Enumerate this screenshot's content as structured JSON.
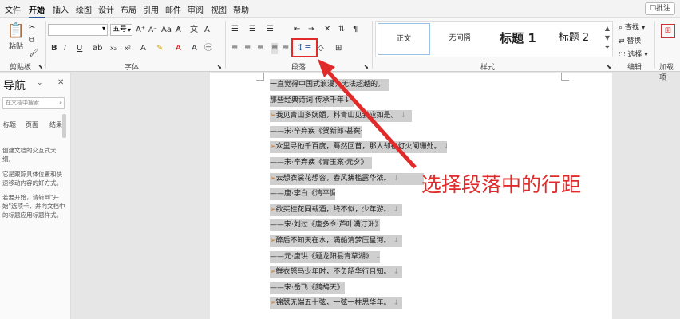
{
  "menu": {
    "items": [
      "文件",
      "开始",
      "插入",
      "绘图",
      "设计",
      "布局",
      "引用",
      "邮件",
      "审阅",
      "视图",
      "帮助"
    ],
    "active": "开始",
    "comment_label": "批注"
  },
  "ribbon": {
    "clipboard": {
      "paste_label": "粘贴",
      "group_label": "剪贴板"
    },
    "font": {
      "font_name": "",
      "font_size": "五号",
      "group_label": "字体",
      "bold": "B",
      "italic": "I",
      "underline": "U"
    },
    "paragraph": {
      "group_label": "段落"
    },
    "styles": {
      "group_label": "样式",
      "items": [
        "正文",
        "无间隔",
        "标题 1",
        "标题 2"
      ]
    },
    "editing": {
      "find_label": "查找",
      "replace_label": "替换",
      "select_label": "选择",
      "group_label": "编辑"
    },
    "addins": {
      "group_label": "加载项"
    }
  },
  "nav": {
    "title": "导航",
    "search_placeholder": "在文档中搜索",
    "tabs": [
      "标题",
      "页面",
      "结果"
    ],
    "help_1": "创建文档的交互式大纲。",
    "help_2": "它是跟踪具体位置和快速移动内容的好方式。",
    "help_3": "若要开始，请转到\"开始\"选项卡，并向文档中的标题应用标题样式。"
  },
  "document": {
    "lines": [
      {
        "text": "一直觉得中国式浪漫，无法超越的。",
        "bullet": false
      },
      {
        "text": "那些经典诗词 传承千年↓",
        "bullet": false
      },
      {
        "text": "我见青山多妩媚，料青山见我应如是。",
        "bullet": true
      },
      {
        "text": "——宋·辛弃疾《贺新郎·甚矣吾衰矣》",
        "bullet": false
      },
      {
        "text": "众里寻他千百度，蓦然回首，那人却在灯火阑珊处。",
        "bullet": true
      },
      {
        "text": "——宋·辛弃疾《青玉案·元夕》",
        "bullet": false
      },
      {
        "text": "云想衣裳花想容，春风拂槛露华浓。",
        "bullet": true
      },
      {
        "text": "——唐·李白《清平调》",
        "bullet": false
      },
      {
        "text": "欲买桂花同载酒，终不似，少年游。",
        "bullet": true
      },
      {
        "text": "——宋·刘过《唐多令·芦叶满汀洲》",
        "bullet": false
      },
      {
        "text": "醉后不知天在水，满船清梦压星河。",
        "bullet": true
      },
      {
        "text": "——元·唐珙《题龙阳县青草湖》",
        "bullet": false
      },
      {
        "text": "鲜衣怒马少年时，不负韶华行且知。",
        "bullet": true
      },
      {
        "text": "——宋·岳飞《鹧鸪天》",
        "bullet": false
      },
      {
        "text": "锦瑟无端五十弦，一弦一柱思华年。",
        "bullet": true
      }
    ],
    "paragraph_mark": "↓"
  },
  "annotation": {
    "text": "选择段落中的行距"
  },
  "colors": {
    "accent": "#2b579a",
    "highlight_red": "#e12b2b",
    "selection": "#cfcfcf"
  }
}
